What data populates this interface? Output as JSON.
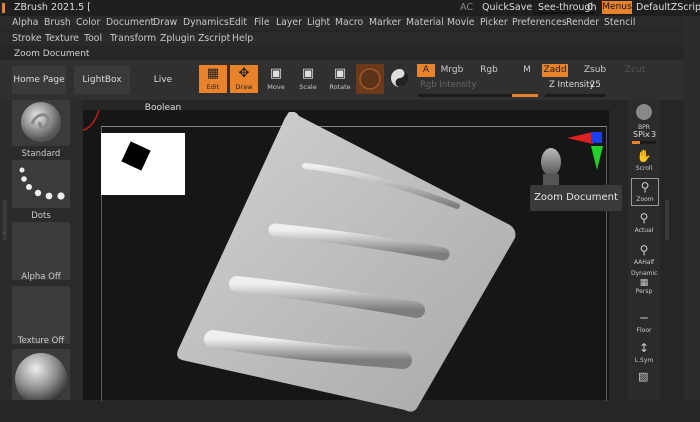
{
  "titlebar": {
    "app_title": "ZBrush 2021.5 [",
    "ac": "AC",
    "quicksave": "QuickSave",
    "see_through_label": "See-through",
    "see_through_value": "0",
    "see_through_level": 0,
    "menus": "Menus",
    "default_script": "DefaultZScript"
  },
  "menubar": {
    "row1": [
      "Alpha",
      "Brush",
      "Color",
      "Document",
      "Draw",
      "Dynamics",
      "Edit",
      "File",
      "Layer",
      "Light",
      "Macro",
      "Marker",
      "Material",
      "Movie",
      "Picker",
      "Preferences",
      "Render",
      "Stencil"
    ],
    "row2": [
      "Stroke",
      "Texture",
      "Tool",
      "Transform",
      "Zplugin",
      "Zscript",
      "Help"
    ]
  },
  "palette_title": "Zoom Document",
  "shelf": {
    "home_page": "Home Page",
    "lightbox": "LightBox",
    "live_boolean": "Live Boolean",
    "edit": "Edit",
    "draw": "Draw",
    "move": "Move",
    "scale": "Scale",
    "rotate": "Rotate",
    "a": "A",
    "mrgb": "Mrgb",
    "rgb": "Rgb",
    "m": "M",
    "zadd": "Zadd",
    "zsub": "Zsub",
    "zcut": "Zcut",
    "rgb_intensity": "Rgb Intensity",
    "z_intensity_label": "Z Intensity",
    "z_intensity_value": "25"
  },
  "lefttray": {
    "brush": "Standard",
    "stroke": "Dots",
    "alpha": "Alpha Off",
    "texture": "Texture Off"
  },
  "rightshelf": {
    "bpr": "BPR",
    "spix_label": "SPix",
    "spix_value": "3",
    "scroll": "Scroll",
    "zoom": "Zoom",
    "actual": "Actual",
    "aahalf": "AAHalf",
    "dynamic": "Dynamic",
    "persp": "Persp",
    "floor": "Floor",
    "lsym": "L.Sym"
  },
  "tooltip": "Zoom Document",
  "colors": {
    "accent": "#e8822b",
    "background": "#262626",
    "canvas": "#161616"
  }
}
